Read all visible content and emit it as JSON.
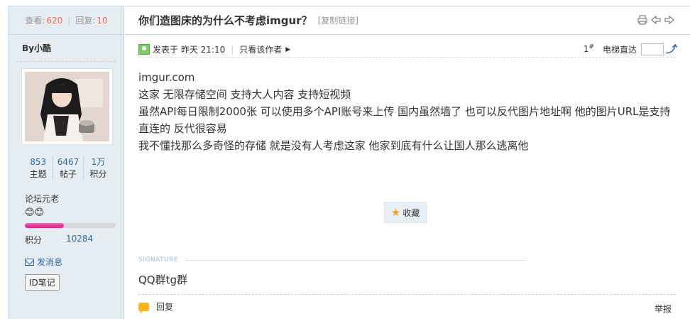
{
  "sidebar": {
    "views_label": "查看:",
    "views_value": "620",
    "replies_label": "回复:",
    "replies_value": "10",
    "author": "By小酷",
    "stats": [
      {
        "value": "853",
        "label": "主题"
      },
      {
        "value": "6467",
        "label": "帖子"
      },
      {
        "value": "1万",
        "label": "积分"
      }
    ],
    "rank": "论坛元老",
    "rank_progress_percent": 43,
    "score_label": "积分",
    "score_value": "10284",
    "send_message": "发消息",
    "id_note": "ID笔记"
  },
  "header": {
    "title": "你们造图床的为什么不考虑imgur？",
    "copy_link": "[复制链接]"
  },
  "post_info": {
    "posted": "发表于 昨天 21:10",
    "author_only": "只看该作者",
    "floor_number": "1",
    "floor_mark": "#",
    "jump_label": "电梯直达"
  },
  "content": {
    "lines": [
      "imgur.com",
      "这家 无限存储空间 支持大人内容 支持短视频",
      "虽然API每日限制2000张 可以使用多个API账号来上传  国内虽然墙了 也可以反代图片地址啊 他的图片URL是支持直连的 反代很容易",
      "我不懂找那么多奇怪的存储 就是没有人考虑这家 他家到底有什么让国人那么逃离他"
    ]
  },
  "favorite_label": "收藏",
  "signature": {
    "label": "SIGNATURE",
    "text": "QQ群tg群"
  },
  "footer": {
    "reply": "回复",
    "report": "举报"
  },
  "colors": {
    "sidebar_bg": "#e5edf2",
    "border": "#c2d5e3",
    "link": "#336699",
    "accent": "#f26c4f"
  }
}
